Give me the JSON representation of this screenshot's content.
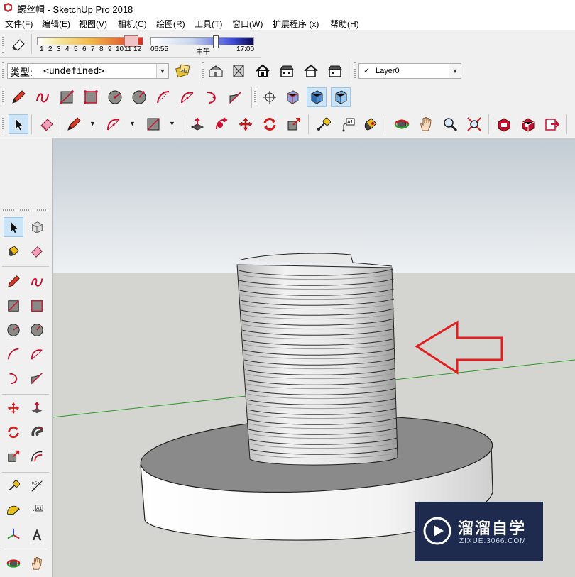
{
  "window": {
    "title": "螺丝帽 - SketchUp Pro 2018"
  },
  "menubar": {
    "items": [
      "文件(F)",
      "编辑(E)",
      "视图(V)",
      "相机(C)",
      "绘图(R)",
      "工具(T)",
      "窗口(W)",
      "扩展程序 (x)",
      "帮助(H)"
    ]
  },
  "shadow_toolbar": {
    "month_ticks": [
      "1",
      "2",
      "3",
      "4",
      "5",
      "6",
      "7",
      "8",
      "9",
      "10",
      "11",
      "12"
    ],
    "time_start": "06:55",
    "time_mid": "中午",
    "time_end": "17:00"
  },
  "type_selector": {
    "label": "类型:",
    "value": "<undefined>"
  },
  "layer_selector": {
    "check": "✓",
    "value": "Layer0"
  },
  "colors": {
    "accent_red": "#e02020",
    "axis_green": "#2e9a2e",
    "pressed_blue": "#cce4f7",
    "sky_top": "#c9d2d8",
    "ground": "#d4d4d0"
  },
  "viewport": {
    "annotation": "red-outline-arrow-pointing-left"
  },
  "watermark": {
    "brand": "溜溜自学",
    "url": "ZIXUE.3066.COM"
  },
  "icons": [
    "eraser-icon",
    "pencil-icon",
    "freehand-icon",
    "rectangle-icon",
    "rotated-rectangle-icon",
    "circle-icon",
    "polygon-icon",
    "arc-icon",
    "two-point-arc-icon",
    "three-point-arc-icon",
    "pie-icon",
    "select-icon",
    "paint-bucket-icon",
    "push-pull-icon",
    "follow-me-icon",
    "move-icon",
    "rotate-icon",
    "scale-icon",
    "offset-icon",
    "tape-measure-icon",
    "text-icon",
    "orbit-icon",
    "pan-icon",
    "zoom-icon",
    "zoom-extents-icon",
    "warehouse-icon",
    "extension-warehouse-icon",
    "send-to-layout-icon",
    "iso-view-icon",
    "top-view-icon",
    "front-view-icon",
    "right-view-icon",
    "back-view-icon",
    "left-view-icon",
    "xray-icon",
    "wireframe-icon",
    "hidden-line-icon",
    "shaded-icon",
    "section-plane-icon",
    "protractor-icon",
    "axes-icon",
    "3d-text-icon",
    "dimension-icon",
    "position-camera-icon",
    "walk-icon",
    "look-around-icon",
    "crosshair-icon",
    "component-icon"
  ]
}
